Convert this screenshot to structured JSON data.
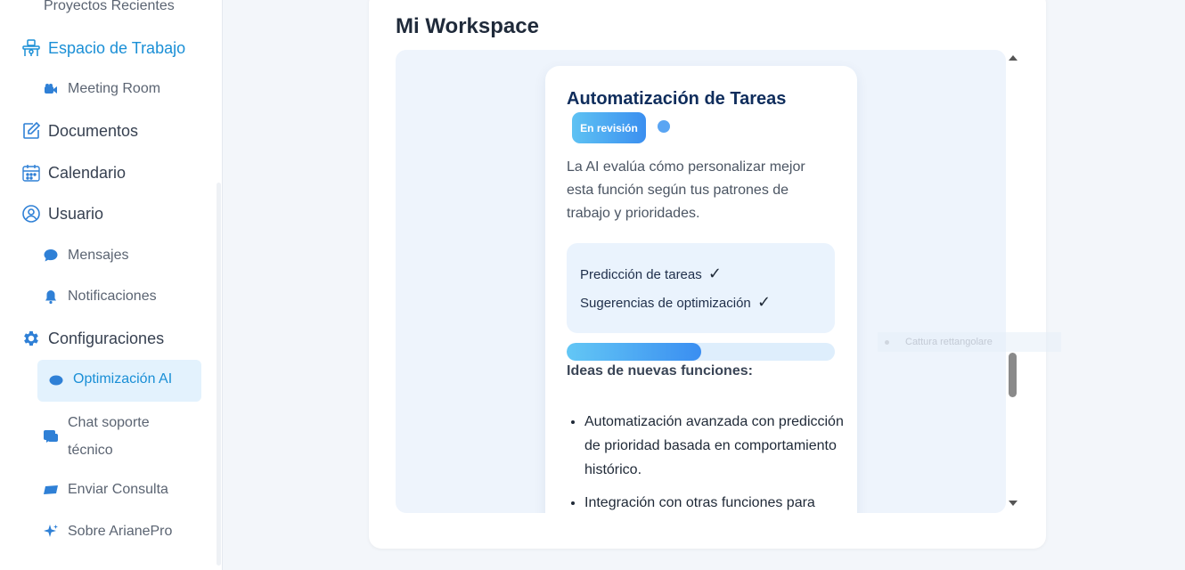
{
  "sidebar": {
    "items": [
      {
        "label": "Proyectos Recientes",
        "icon": "folder-icon",
        "level": "sub"
      },
      {
        "label": "Espacio de Trabajo",
        "icon": "workspace-icon",
        "level": "main",
        "active": true
      },
      {
        "label": "Meeting Room",
        "icon": "video-camera-icon",
        "level": "sub"
      },
      {
        "label": "Documentos",
        "icon": "edit-document-icon",
        "level": "main"
      },
      {
        "label": "Calendario",
        "icon": "calendar-icon",
        "level": "main"
      },
      {
        "label": "Usuario",
        "icon": "user-circle-icon",
        "level": "main"
      },
      {
        "label": "Mensajes",
        "icon": "chat-bubble-icon",
        "level": "sub"
      },
      {
        "label": "Notificaciones",
        "icon": "bell-icon",
        "level": "sub"
      },
      {
        "label": "Configuraciones",
        "icon": "gear-icon",
        "level": "main"
      },
      {
        "label": "Optimización AI",
        "icon": "cloud-icon",
        "level": "sub",
        "selected": true
      },
      {
        "label": "Chat soporte técnico",
        "icon": "support-chat-icon",
        "level": "sub"
      },
      {
        "label": "Enviar Consulta",
        "icon": "send-icon",
        "level": "sub"
      },
      {
        "label": "Sobre ArianePro",
        "icon": "sparkle-icon",
        "level": "sub"
      }
    ]
  },
  "main": {
    "title": "Mi Workspace",
    "card": {
      "title": "Automatización de Tareas",
      "badge": "En revisión",
      "description": "La AI evalúa cómo personalizar mejor esta función según tus patrones de trabajo y prioridades.",
      "features": [
        {
          "label": "Predicción de tareas",
          "check": "✓"
        },
        {
          "label": "Sugerencias de optimización",
          "check": "✓"
        }
      ],
      "progress_fraction": 0.5,
      "ideas_title": "Ideas de nuevas funciones:",
      "ideas": [
        "Automatización avanzada con predicción de prioridad basada en comportamiento histórico.",
        "Integración con otras funciones para"
      ]
    }
  },
  "overlay": {
    "ghost_label": "Cattura rettangolare"
  },
  "colors": {
    "accent": "#1a8fd6",
    "selected_bg": "#e3f2fd",
    "card_title": "#0f2d5c",
    "badge_gradient_start": "#5ec2f3",
    "badge_gradient_end": "#3b8ff0"
  }
}
